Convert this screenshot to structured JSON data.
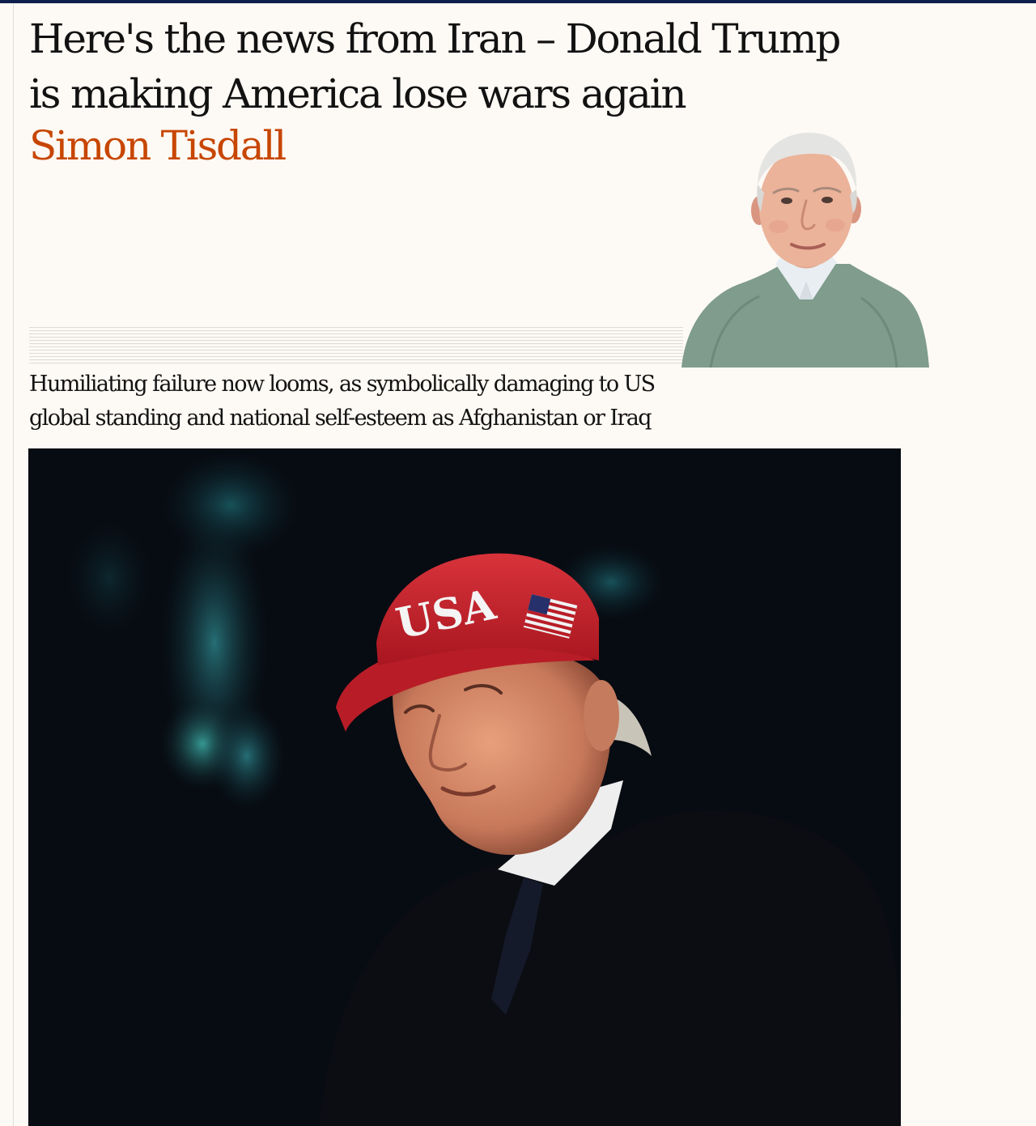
{
  "article": {
    "headline_line1": "Here's the news from Iran – Donald Trump",
    "headline_line2": "is making America lose wars again",
    "byline": "Simon Tisdall",
    "standfirst_line1": "Humiliating failure now looms, as symbolically damaging to US",
    "standfirst_line2": "global standing and national self-esteem as Afghanistan or Iraq"
  },
  "main_photo": {
    "cap_text": "USA"
  },
  "colors": {
    "background": "#fdf9f4",
    "headline": "#121212",
    "byline_accent": "#c74600",
    "top_bar": "#0e1f4b",
    "cap_red": "#c8202b"
  }
}
